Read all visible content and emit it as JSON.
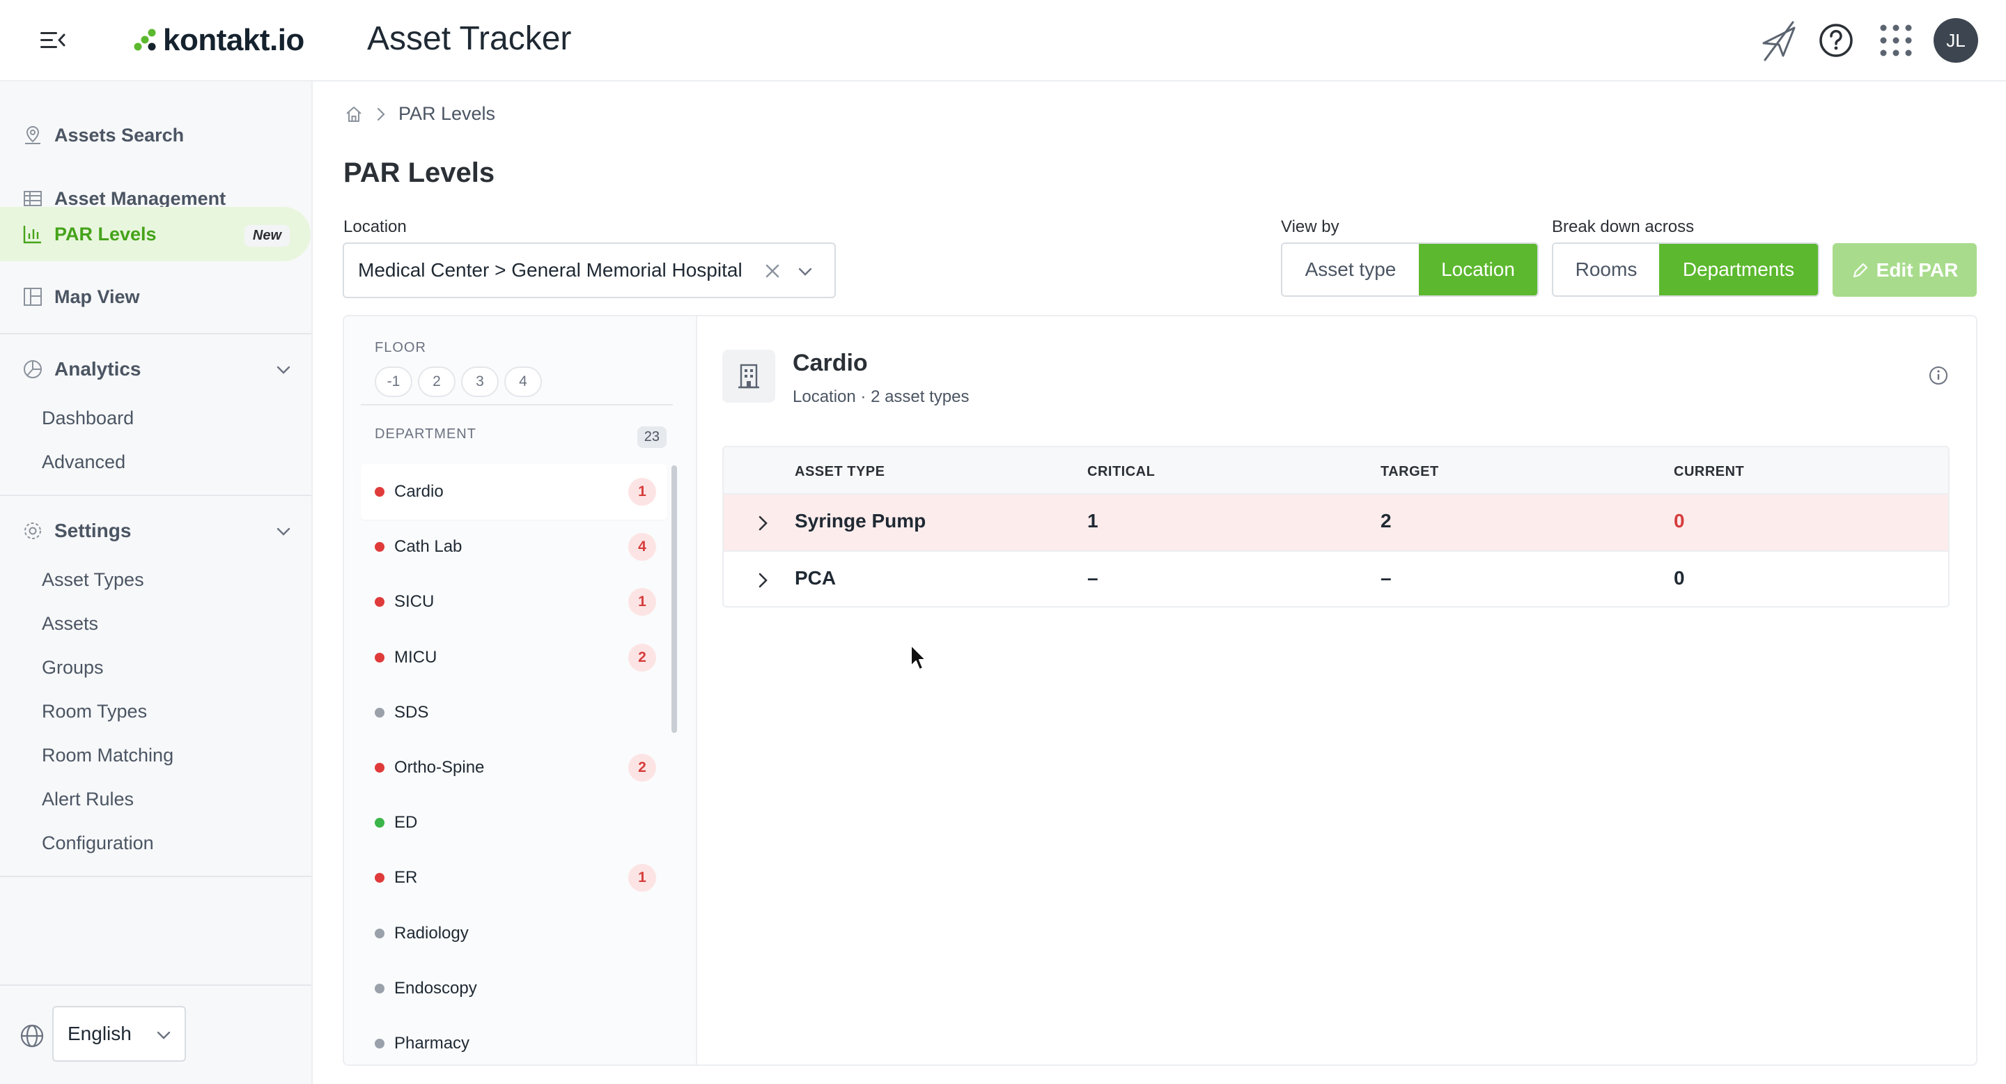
{
  "header": {
    "logo_text": "kontakt.io",
    "app_title": "Asset Tracker",
    "avatar_initials": "JL",
    "brand_color": "#5cb82e"
  },
  "sidebar": {
    "items": [
      {
        "label": "Assets Search",
        "icon": "map-pin-icon"
      },
      {
        "label": "Asset Management",
        "icon": "table-icon"
      },
      {
        "label": "PAR Levels",
        "icon": "bar-chart-icon",
        "badge": "New",
        "active": true
      },
      {
        "label": "Map View",
        "icon": "layout-icon"
      }
    ],
    "analytics": {
      "label": "Analytics",
      "items": [
        "Dashboard",
        "Advanced"
      ]
    },
    "settings": {
      "label": "Settings",
      "items": [
        "Asset Types",
        "Assets",
        "Groups",
        "Room Types",
        "Room Matching",
        "Alert Rules",
        "Configuration"
      ]
    },
    "language": "English"
  },
  "breadcrumb": {
    "current": "PAR Levels"
  },
  "page": {
    "title": "PAR Levels",
    "location_label": "Location",
    "location_value": "Medical Center > General Memorial Hospital",
    "view_by_label": "View by",
    "view_by_options": [
      "Asset type",
      "Location"
    ],
    "view_by_selected": "Location",
    "breakdown_label": "Break down across",
    "breakdown_options": [
      "Rooms",
      "Departments"
    ],
    "breakdown_selected": "Departments",
    "edit_button": "Edit PAR"
  },
  "filters": {
    "floor_label": "FLOOR",
    "floors": [
      "-1",
      "2",
      "3",
      "4"
    ],
    "department_label": "DEPARTMENT",
    "department_count": "23",
    "departments": [
      {
        "name": "Cardio",
        "status": "red",
        "count": "1",
        "selected": true
      },
      {
        "name": "Cath Lab",
        "status": "red",
        "count": "4"
      },
      {
        "name": "SICU",
        "status": "red",
        "count": "1"
      },
      {
        "name": "MICU",
        "status": "red",
        "count": "2"
      },
      {
        "name": "SDS",
        "status": "gray",
        "count": ""
      },
      {
        "name": "Ortho-Spine",
        "status": "red",
        "count": "2"
      },
      {
        "name": "ED",
        "status": "green",
        "count": ""
      },
      {
        "name": "ER",
        "status": "red",
        "count": "1"
      },
      {
        "name": "Radiology",
        "status": "gray",
        "count": ""
      },
      {
        "name": "Endoscopy",
        "status": "gray",
        "count": ""
      },
      {
        "name": "Pharmacy",
        "status": "gray",
        "count": ""
      }
    ]
  },
  "detail": {
    "title": "Cardio",
    "subtitle": "Location · 2 asset types",
    "columns": [
      "ASSET TYPE",
      "CRITICAL",
      "TARGET",
      "CURRENT"
    ],
    "rows": [
      {
        "asset_type": "Syringe Pump",
        "critical": "1",
        "target": "2",
        "current": "0",
        "alert": true
      },
      {
        "asset_type": "PCA",
        "critical": "–",
        "target": "–",
        "current": "0",
        "alert": false
      }
    ]
  }
}
